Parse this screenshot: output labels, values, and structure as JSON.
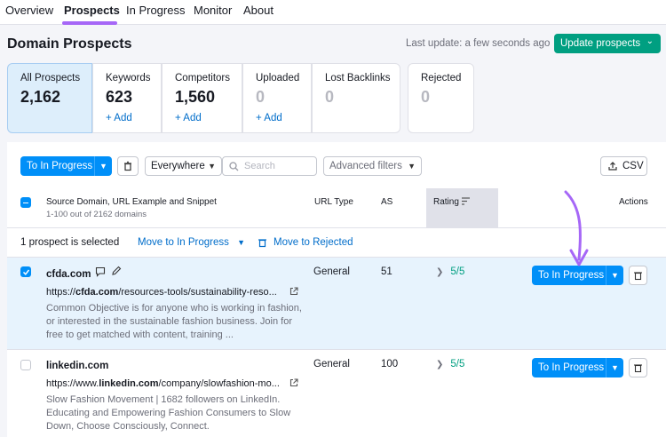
{
  "nav": {
    "tabs": [
      {
        "label": "Overview"
      },
      {
        "label": "Prospects"
      },
      {
        "label": "In Progress"
      },
      {
        "label": "Monitor"
      },
      {
        "label": "About"
      }
    ],
    "active": "Prospects"
  },
  "header": {
    "title": "Domain Prospects",
    "last_update": "Last update: a few seconds ago",
    "update_button": "Update prospects"
  },
  "cards": [
    {
      "label": "All Prospects",
      "value": "2,162",
      "add": ""
    },
    {
      "label": "Keywords",
      "value": "623",
      "add": "+ Add"
    },
    {
      "label": "Competitors",
      "value": "1,560",
      "add": "+ Add"
    },
    {
      "label": "Uploaded",
      "value": "0",
      "add": "+ Add"
    },
    {
      "label": "Lost Backlinks",
      "value": "0",
      "add": ""
    },
    {
      "label": "Rejected",
      "value": "0",
      "add": ""
    }
  ],
  "toolbar": {
    "to_in_progress": "To In Progress",
    "scope": "Everywhere",
    "search_placeholder": "Search",
    "advanced_filters": "Advanced filters",
    "csv": "CSV"
  },
  "table": {
    "col_source": "Source Domain, URL Example and Snippet",
    "col_source_sub": "1-100 out of 2162 domains",
    "col_url_type": "URL Type",
    "col_as": "AS",
    "col_rating": "Rating",
    "col_actions": "Actions"
  },
  "selection": {
    "count_text": "1 prospect is selected",
    "move_in_progress": "Move to In Progress",
    "move_rejected": "Move to Rejected"
  },
  "rows": [
    {
      "domain": "cfda.com",
      "url_prefix": "https://",
      "url_bold": "cfda.com",
      "url_rest": "/resources-tools/sustainability-reso...",
      "snippet": "Common Objective is for anyone who is working in fashion, or interested in the sustainable fashion business. Join for free to get matched with content, training ...",
      "url_type": "General",
      "as": "51",
      "rating": "5/5",
      "action": "To In Progress",
      "selected": true
    },
    {
      "domain": "linkedin.com",
      "url_prefix": "https://www.",
      "url_bold": "linkedin.com",
      "url_rest": "/company/slowfashion-mo...",
      "snippet": "Slow Fashion Movement | 1682 followers on LinkedIn. Educating and Empowering Fashion Consumers to Slow Down, Choose Consciously, Connect.",
      "url_type": "General",
      "as": "100",
      "rating": "5/5",
      "action": "To In Progress",
      "selected": false
    }
  ],
  "colors": {
    "primary": "#008ff8",
    "success": "#009f81",
    "accent": "#a667f7",
    "link": "#006dca"
  }
}
